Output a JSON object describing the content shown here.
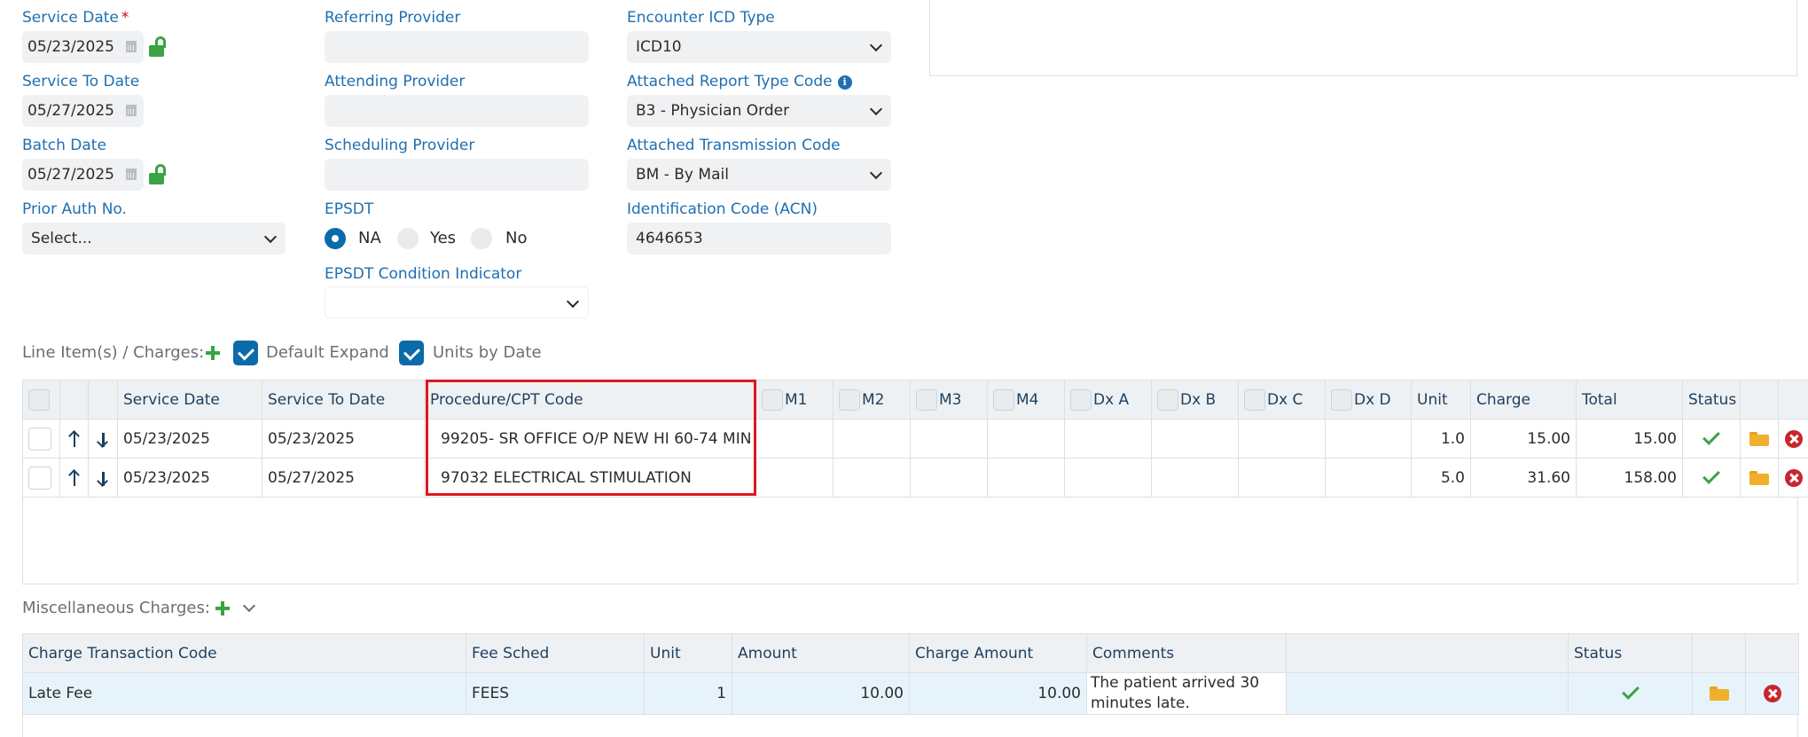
{
  "form": {
    "service_date": {
      "label": "Service Date",
      "required": "*",
      "value": "05/23/2025"
    },
    "service_to_date": {
      "label": "Service To Date",
      "value": "05/27/2025"
    },
    "batch_date": {
      "label": "Batch Date",
      "value": "05/27/2025"
    },
    "prior_auth": {
      "label": "Prior Auth No.",
      "value": "Select..."
    },
    "referring_provider": {
      "label": "Referring Provider",
      "value": ""
    },
    "attending_provider": {
      "label": "Attending Provider",
      "value": ""
    },
    "scheduling_provider": {
      "label": "Scheduling Provider",
      "value": ""
    },
    "epsdt": {
      "label": "EPSDT",
      "options": [
        "NA",
        "Yes",
        "No"
      ],
      "selected": "NA"
    },
    "epsdt_condition": {
      "label": "EPSDT Condition Indicator",
      "value": ""
    },
    "encounter_icd_type": {
      "label": "Encounter ICD Type",
      "value": "ICD10"
    },
    "attached_report_type": {
      "label": "Attached Report Type Code",
      "value": "B3 - Physician Order"
    },
    "attached_transmission": {
      "label": "Attached Transmission Code",
      "value": "BM - By Mail"
    },
    "identification_code": {
      "label": "Identification Code (ACN)",
      "value": "4646653"
    }
  },
  "line_items": {
    "section_label": "Line Item(s) / Charges:",
    "default_expand_label": "Default Expand",
    "units_by_date_label": "Units by Date",
    "columns": [
      "Service Date",
      "Service To Date",
      "Procedure/CPT Code",
      "M1",
      "M2",
      "M3",
      "M4",
      "Dx A",
      "Dx B",
      "Dx C",
      "Dx D",
      "Unit",
      "Charge",
      "Total",
      "Status"
    ],
    "rows": [
      {
        "service_date": "05/23/2025",
        "service_to_date": "05/23/2025",
        "procedure": "99205- SR OFFICE O/P NEW HI 60-74 MIN",
        "unit": "1.0",
        "charge": "15.00",
        "total": "15.00"
      },
      {
        "service_date": "05/23/2025",
        "service_to_date": "05/27/2025",
        "procedure": "97032 ELECTRICAL STIMULATION",
        "unit": "5.0",
        "charge": "31.60",
        "total": "158.00"
      }
    ]
  },
  "misc_charges": {
    "section_label": "Miscellaneous Charges:",
    "columns": [
      "Charge Transaction Code",
      "Fee Sched",
      "Unit",
      "Amount",
      "Charge Amount",
      "Comments",
      "Status"
    ],
    "rows": [
      {
        "code": "Late Fee",
        "fee_sched": "FEES",
        "unit": "1",
        "amount": "10.00",
        "charge_amount": "10.00",
        "comments": "The patient arrived 30 minutes late."
      }
    ]
  },
  "colors": {
    "label_blue": "#1f6fb2",
    "accent": "#0b6aa8",
    "success": "#3aa344",
    "danger": "#c9252c",
    "folder": "#f0b02c",
    "highlight": "#e0161f"
  }
}
